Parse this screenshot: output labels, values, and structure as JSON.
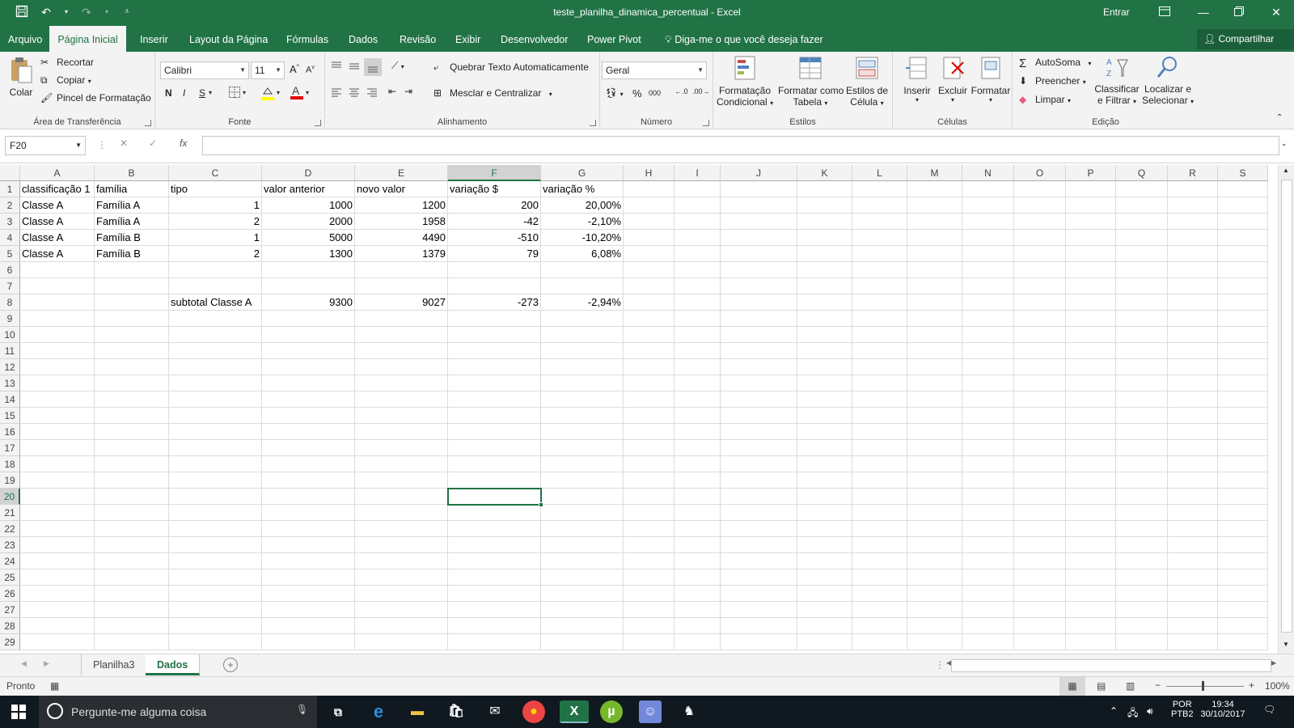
{
  "window": {
    "title": "teste_planilha_dinamica_percentual  -  Excel",
    "sign_in": "Entrar"
  },
  "menu": {
    "tabs": [
      "Arquivo",
      "Página Inicial",
      "Inserir",
      "Layout da Página",
      "Fórmulas",
      "Dados",
      "Revisão",
      "Exibir",
      "Desenvolvedor",
      "Power Pivot"
    ],
    "active_tab": "Página Inicial",
    "tell_me": "Diga-me o que você deseja fazer",
    "share": "Compartilhar"
  },
  "ribbon": {
    "clipboard": {
      "paste": "Colar",
      "cut": "Recortar",
      "copy": "Copiar",
      "format_painter": "Pincel de Formatação",
      "label": "Área de Transferência"
    },
    "font": {
      "name": "Calibri",
      "size": "11",
      "bold": "N",
      "italic": "I",
      "underline": "S",
      "label": "Fonte"
    },
    "alignment": {
      "wrap_text": "Quebrar Texto Automaticamente",
      "merge_center": "Mesclar e Centralizar",
      "label": "Alinhamento"
    },
    "number": {
      "format": "Geral",
      "percent": "%",
      "thousands": "000",
      "label": "Número"
    },
    "styles": {
      "conditional": "Formatação Condicional",
      "conditional_l1": "Formatação",
      "conditional_l2": "Condicional",
      "table_l1": "Formatar como",
      "table_l2": "Tabela",
      "cell_l1": "Estilos de",
      "cell_l2": "Célula",
      "label": "Estilos"
    },
    "cells": {
      "insert": "Inserir",
      "delete": "Excluir",
      "format": "Formatar",
      "label": "Células"
    },
    "editing": {
      "autosum": "AutoSoma",
      "fill": "Preencher",
      "clear": "Limpar",
      "sort_l1": "Classificar",
      "sort_l2": "e Filtrar",
      "find_l1": "Localizar e",
      "find_l2": "Selecionar",
      "label": "Edição"
    }
  },
  "formula_bar": {
    "name_box": "F20",
    "fx": "fx",
    "formula": ""
  },
  "columns": [
    "A",
    "B",
    "C",
    "D",
    "E",
    "F",
    "G",
    "H",
    "I",
    "J",
    "K",
    "L",
    "M",
    "N",
    "O",
    "P",
    "Q",
    "R",
    "S"
  ],
  "selected_column": "F",
  "selected_row": "20",
  "rows": [
    "1",
    "2",
    "3",
    "4",
    "5",
    "6",
    "7",
    "8",
    "9",
    "10",
    "11",
    "12",
    "13",
    "14",
    "15",
    "16",
    "17",
    "18",
    "19",
    "20",
    "21",
    "22",
    "23",
    "24",
    "25",
    "26",
    "27",
    "28",
    "29"
  ],
  "cells": {
    "r1": [
      "classificação 1",
      "família",
      "tipo",
      "valor anterior",
      "novo valor",
      "variação $",
      "variação %"
    ],
    "r2": [
      "Classe A",
      "Família A",
      "1",
      "1000",
      "1200",
      "200",
      "20,00%"
    ],
    "r3": [
      "Classe A",
      "Família A",
      "2",
      "2000",
      "1958",
      "-42",
      "-2,10%"
    ],
    "r4": [
      "Classe A",
      "Família B",
      "1",
      "5000",
      "4490",
      "-510",
      "-10,20%"
    ],
    "r5": [
      "Classe A",
      "Família B",
      "2",
      "1300",
      "1379",
      "79",
      "6,08%"
    ],
    "r8": [
      "",
      "",
      "subtotal Classe A",
      "9300",
      "9027",
      "-273",
      "-2,94%"
    ]
  },
  "sheets": [
    "Planilha3",
    "Dados"
  ],
  "active_sheet": "Dados",
  "status": {
    "mode": "Pronto",
    "zoom": "100%"
  },
  "taskbar": {
    "search_placeholder": "Pergunte-me alguma coisa",
    "lang1": "POR",
    "lang2": "PTB2",
    "time": "19:34",
    "date": "30/10/2017"
  },
  "colors": {
    "excel_green": "#217346",
    "grid_line": "#dadcdd"
  }
}
